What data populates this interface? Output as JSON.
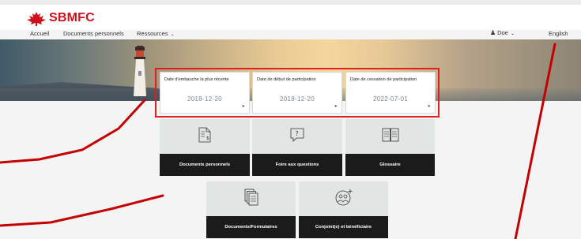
{
  "brand": {
    "name": "SBMFC",
    "color": "#d0111b",
    "logo_icon": "maple-leaf-icon"
  },
  "nav": {
    "home": "Accueil",
    "documents": "Documents personnels",
    "resources": "Ressources",
    "resources_chevron": "chevron-down-icon"
  },
  "user": {
    "name": "Doe",
    "icon": "user-icon",
    "chevron": "chevron-down-icon"
  },
  "language": "English",
  "cards": [
    {
      "title": "Date d'embauche la plus récente",
      "date": "2018-12-20"
    },
    {
      "title": "Date de début de participation",
      "date": "2018-12-20"
    },
    {
      "title": "Date de cessation de participation",
      "date": "2022-07-01"
    }
  ],
  "tiles": [
    {
      "label": "Documents personnels",
      "icon": "document-dollar-icon"
    },
    {
      "label": "Foire aux questions",
      "icon": "question-bubble-icon"
    },
    {
      "label": "Glossaire",
      "icon": "open-book-icon"
    },
    {
      "label": "Documents/Formulaires",
      "icon": "document-stack-icon"
    },
    {
      "label": "Conjoint(e) et bénéficiaire",
      "icon": "people-add-icon"
    }
  ],
  "colors": {
    "highlight": "#e02020",
    "annotation": "#c40000",
    "tile_bg": "#e1e6e5",
    "tile_label_bg": "#1b1b1b"
  }
}
